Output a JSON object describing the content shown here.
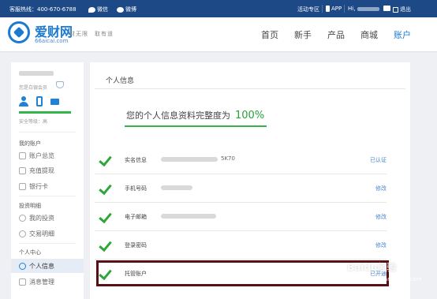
{
  "topbar": {
    "hotline": "客服热线：400-670-6788",
    "wechat": "微信",
    "weibo": "微博",
    "activity": "活动专区",
    "app": "APP",
    "hi": "Hi,",
    "logout": "退出"
  },
  "header": {
    "brand": "爱财网",
    "domain": "66aicai.com",
    "slogan": "财无限　取有道",
    "nav": [
      {
        "label": "首页"
      },
      {
        "label": "新手"
      },
      {
        "label": "产品"
      },
      {
        "label": "商城"
      },
      {
        "label": "账户"
      }
    ]
  },
  "sidebar": {
    "member": "您是白银会员",
    "security_level": "安全等级：高",
    "sections": [
      {
        "title": "我的账户",
        "items": [
          "账户总览",
          "充值提现",
          "银行卡"
        ]
      },
      {
        "title": "投资明细",
        "items": [
          "我的投资",
          "交易明细"
        ]
      },
      {
        "title": "个人中心",
        "items": [
          "个人信息",
          "消息管理"
        ]
      }
    ]
  },
  "main": {
    "title": "个人信息",
    "completeness_text": "您的个人信息资料完整度为",
    "completeness_pct": "100%",
    "rows": [
      {
        "label": "实名信息",
        "value_tail": "5K70",
        "action": "已认证"
      },
      {
        "label": "手机号码",
        "value_tail": "",
        "action": "修改"
      },
      {
        "label": "电子邮箱",
        "value_tail": "",
        "action": "修改"
      },
      {
        "label": "登录密码",
        "value_tail": "",
        "action": "修改"
      },
      {
        "label": "托管账户",
        "value_tail": "",
        "action": "已开通"
      }
    ]
  },
  "watermark": {
    "main": "Baidu经验",
    "sub": "jingyan.baidu.com"
  },
  "colors": {
    "topbar": "#1d4a86",
    "accent": "#1a7ad0",
    "success": "#2fa63a",
    "highlight_border": "#5a0f14"
  }
}
